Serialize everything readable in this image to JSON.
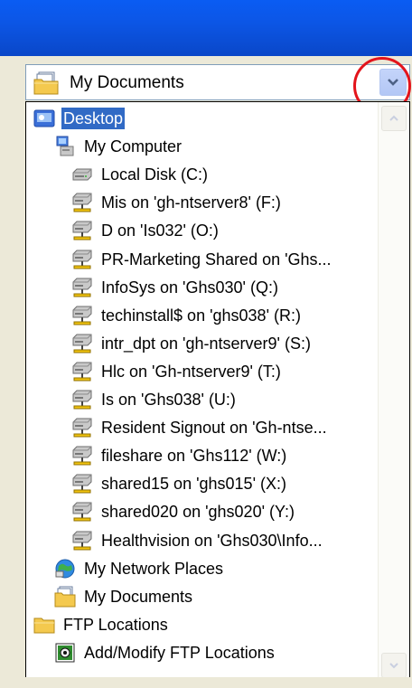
{
  "combo": {
    "label": "My Documents",
    "icon": "my-documents-icon",
    "dropdown_icon": "chevron-down-icon"
  },
  "colors": {
    "titlebar": "#0a5cf3",
    "selection": "#316ac5",
    "highlight_circle": "#e3141b"
  },
  "items": [
    {
      "label": "Desktop",
      "icon": "desktop-icon",
      "level": 0,
      "selected": true
    },
    {
      "label": "My Computer",
      "icon": "my-computer-icon",
      "level": 1
    },
    {
      "label": "Local Disk (C:)",
      "icon": "local-disk-icon",
      "level": 2
    },
    {
      "label": "Mis on 'gh-ntserver8' (F:)",
      "icon": "network-drive-icon",
      "level": 2
    },
    {
      "label": "D on 'Is032' (O:)",
      "icon": "network-drive-icon",
      "level": 2
    },
    {
      "label": "PR-Marketing Shared on 'Ghs...",
      "icon": "network-drive-icon",
      "level": 2
    },
    {
      "label": "InfoSys on 'Ghs030' (Q:)",
      "icon": "network-drive-icon",
      "level": 2
    },
    {
      "label": "techinstall$ on 'ghs038' (R:)",
      "icon": "network-drive-icon",
      "level": 2
    },
    {
      "label": "intr_dpt on 'gh-ntserver9' (S:)",
      "icon": "network-drive-icon",
      "level": 2
    },
    {
      "label": "Hlc on 'Gh-ntserver9' (T:)",
      "icon": "network-drive-icon",
      "level": 2
    },
    {
      "label": "Is on 'Ghs038' (U:)",
      "icon": "network-drive-icon",
      "level": 2
    },
    {
      "label": "Resident Signout on 'Gh-ntse...",
      "icon": "network-drive-icon",
      "level": 2
    },
    {
      "label": "fileshare on 'Ghs112' (W:)",
      "icon": "network-drive-icon",
      "level": 2
    },
    {
      "label": "shared15 on 'ghs015' (X:)",
      "icon": "network-drive-icon",
      "level": 2
    },
    {
      "label": "shared020 on 'ghs020' (Y:)",
      "icon": "network-drive-icon",
      "level": 2
    },
    {
      "label": "Healthvision on 'Ghs030\\Info...",
      "icon": "network-drive-icon",
      "level": 2
    },
    {
      "label": "My Network Places",
      "icon": "network-places-icon",
      "level": 1
    },
    {
      "label": "My Documents",
      "icon": "my-documents-icon",
      "level": 1
    },
    {
      "label": "FTP Locations",
      "icon": "folder-icon",
      "level": 0
    },
    {
      "label": "Add/Modify FTP Locations",
      "icon": "ftp-icon",
      "level": 1
    }
  ],
  "scrollbar": {
    "up_icon": "scroll-up-icon",
    "down_icon": "scroll-down-icon"
  }
}
